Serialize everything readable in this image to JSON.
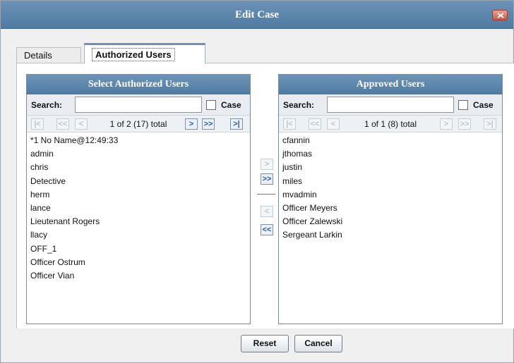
{
  "dialog": {
    "title": "Edit Case"
  },
  "tabs": [
    {
      "label": "Details"
    },
    {
      "label": "Authorized Users"
    }
  ],
  "left_panel": {
    "header": "Select Authorized Users",
    "search_label": "Search:",
    "search_value": "",
    "case_label": "Case",
    "case_checked": false,
    "pager_text": "1 of 2 (17) total",
    "items": [
      "*1 No Name@12:49:33",
      "admin",
      "chris",
      "Detective",
      "herm",
      "lance",
      "Lieutenant Rogers",
      "llacy",
      "OFF_1",
      "Officer Ostrum",
      "Officer Vian"
    ]
  },
  "right_panel": {
    "header": "Approved Users",
    "search_label": "Search:",
    "search_value": "",
    "case_label": "Case",
    "case_checked": false,
    "pager_text": "1 of 1 (8) total",
    "items": [
      "cfannin",
      "jthomas",
      "justin",
      "miles",
      "mvadmin",
      "Officer Meyers",
      "Officer Zalewski",
      "Sergeant Larkin"
    ]
  },
  "footer": {
    "reset_label": "Reset",
    "cancel_label": "Cancel"
  },
  "icons": {
    "first": "first-page-icon",
    "prev_block": "previous-block-icon",
    "prev": "previous-page-icon",
    "next": "next-page-icon",
    "next_block": "next-block-icon",
    "last": "last-page-icon",
    "close": "close-icon"
  },
  "colors": {
    "header_blue": "#5a84ab",
    "accent_link": "#2a56a8"
  }
}
